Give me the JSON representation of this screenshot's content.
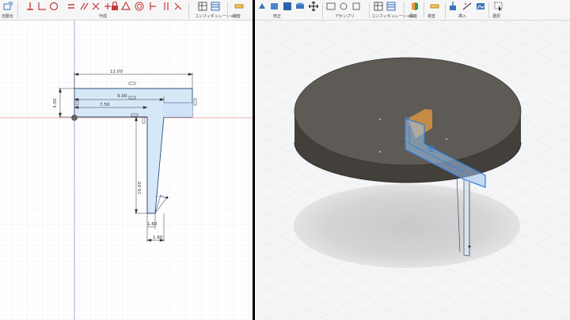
{
  "left_toolbar": {
    "groups": [
      "作成",
      "拘束",
      "コンフィギュレーション",
      "検査"
    ],
    "first_label": "自動化"
  },
  "right_toolbar": {
    "groups": [
      "修正",
      "アセンブリ",
      "コンフィギュレーション",
      "構築",
      "検査",
      "挿入",
      "選択"
    ]
  },
  "sketch": {
    "dimensions": {
      "overall_width": "12.00",
      "inner_width": "9.00",
      "offset_width": "7.50",
      "height": "3.00",
      "leg_height": "10.00",
      "leg_bottom_a": "1.60",
      "leg_bottom_b": "1.60"
    }
  },
  "colors": {
    "accent": "#0696d7",
    "sketch_fill": "#d6e8f8",
    "sketch_line": "#2f4f7a",
    "table_top": "#5e5b57",
    "table_side": "#433f3b",
    "selection": "#2f7fd8",
    "orange": "#e89a3c",
    "origin_red": "#e46b6b"
  }
}
